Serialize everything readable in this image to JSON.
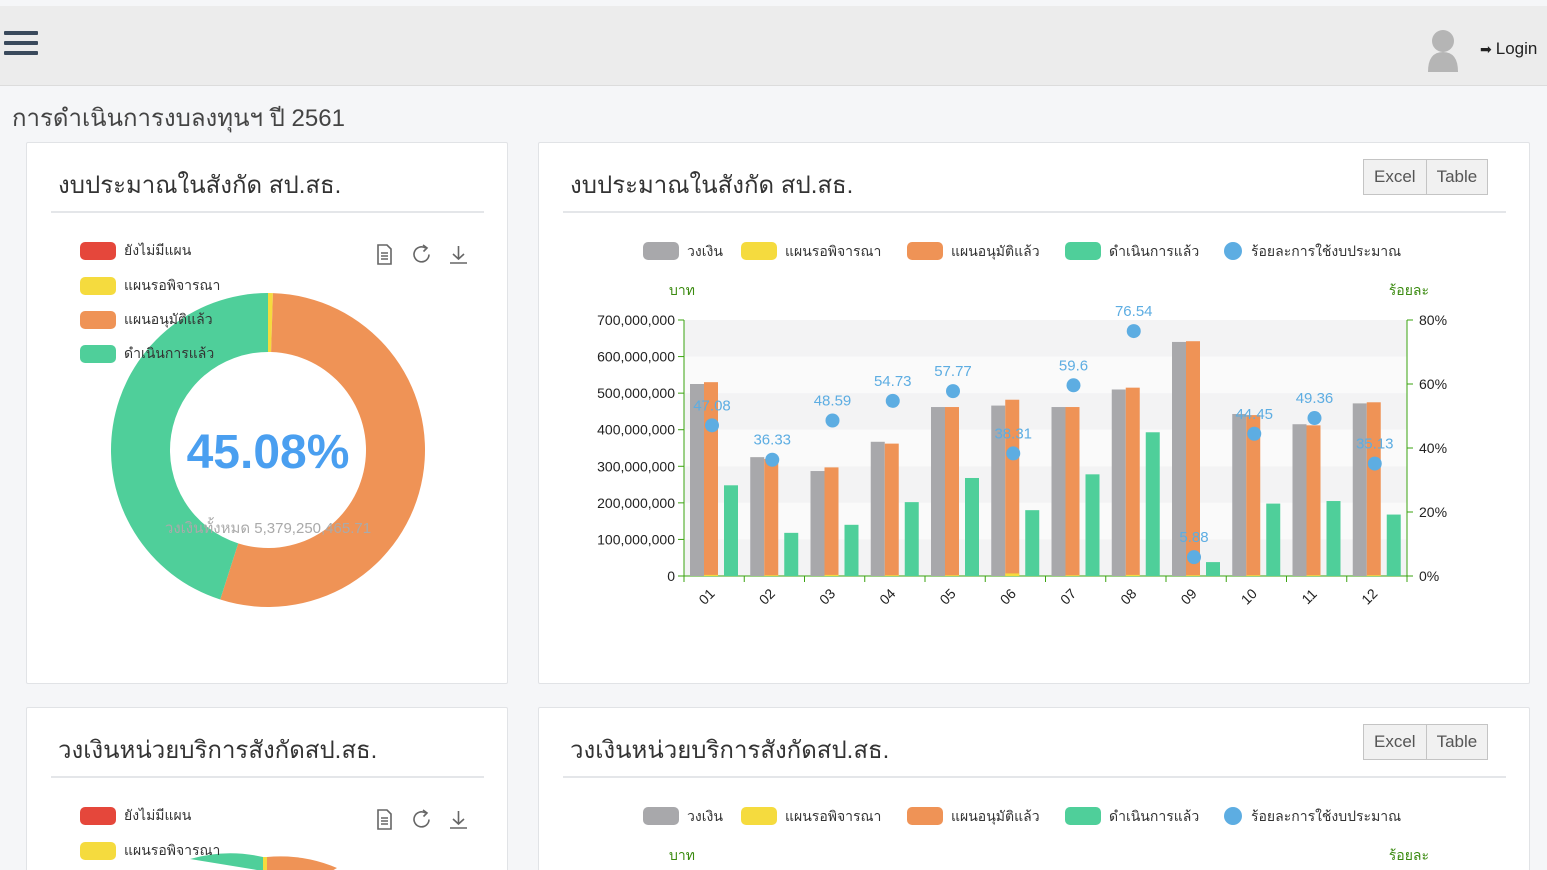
{
  "header": {
    "login_label": "Login",
    "menu_icon": "hamburger-menu-icon",
    "avatar_icon": "user-avatar-icon",
    "login_icon": "sign-in-icon"
  },
  "page": {
    "title": "การดำเนินการงบลงทุนฯ ปี 2561"
  },
  "colors": {
    "budget": "#a8a8ab",
    "pending": "#f5db3e",
    "approved": "#ef9356",
    "done": "#4fcf9a",
    "no_plan": "#e5473b",
    "percent": "#5dade2",
    "axis_green": "#3aa30f"
  },
  "panel1": {
    "title": "งบประมาณในสังกัด สป.สธ.",
    "legend": [
      "ยังไม่มีแผน",
      "แผนรอพิจารณา",
      "แผนอนุมัติแล้ว",
      "ดำเนินการแล้ว"
    ],
    "tools": [
      "document-icon",
      "refresh-icon",
      "download-icon"
    ],
    "center_value": "45.08%",
    "subtitle": "วงเงินทั้งหมด 5,379,250,465.71"
  },
  "panel2": {
    "title": "งบประมาณในสังกัด สป.สธ.",
    "excel_label": "Excel",
    "table_label": "Table",
    "legend": [
      "วงเงิน",
      "แผนรอพิจารณา",
      "แผนอนุมัติแล้ว",
      "ดำเนินการแล้ว",
      "ร้อยละการใช้งบประมาณ"
    ],
    "left_axis_name": "บาท",
    "right_axis_name": "ร้อยละ"
  },
  "panel3": {
    "title": "วงเงินหน่วยบริการสังกัดสป.สธ.",
    "legend": [
      "ยังไม่มีแผน",
      "แผนรอพิจารณา"
    ]
  },
  "panel4": {
    "title": "วงเงินหน่วยบริการสังกัดสป.สธ.",
    "excel_label": "Excel",
    "table_label": "Table",
    "legend": [
      "วงเงิน",
      "แผนรอพิจารณา",
      "แผนอนุมัติแล้ว",
      "ดำเนินการแล้ว",
      "ร้อยละการใช้งบประมาณ"
    ],
    "left_axis_name": "บาท",
    "right_axis_name": "ร้อยละ"
  },
  "chart_data": [
    {
      "type": "pie",
      "variant": "donut",
      "categories": [
        "ยังไม่มีแผน",
        "แผนรอพิจารณา",
        "แผนอนุมัติแล้ว",
        "ดำเนินการแล้ว"
      ],
      "values": [
        0.0,
        0.5,
        54.42,
        45.08
      ],
      "unit": "%"
    },
    {
      "type": "bar",
      "categories": [
        "01",
        "02",
        "03",
        "04",
        "05",
        "06",
        "07",
        "08",
        "09",
        "10",
        "11",
        "12"
      ],
      "series": [
        {
          "name": "วงเงิน",
          "values": [
            525000000,
            325000000,
            287000000,
            367000000,
            462000000,
            466000000,
            462000000,
            510000000,
            640000000,
            443000000,
            415000000,
            472000000
          ]
        },
        {
          "name": "แผนรอพิจารณา",
          "values": [
            3000000,
            2000000,
            3000000,
            2000000,
            2000000,
            7000000,
            2000000,
            3000000,
            2000000,
            2000000,
            2000000,
            2000000
          ]
        },
        {
          "name": "แผนอนุมัติแล้ว",
          "values": [
            530000000,
            320000000,
            297000000,
            362000000,
            462000000,
            482000000,
            462000000,
            515000000,
            642000000,
            440000000,
            412000000,
            475000000
          ]
        },
        {
          "name": "ดำเนินการแล้ว",
          "values": [
            248000000,
            118000000,
            140000000,
            202000000,
            268000000,
            180000000,
            278000000,
            393000000,
            38000000,
            198000000,
            205000000,
            168000000
          ]
        },
        {
          "name": "ร้อยละการใช้งบประมาณ",
          "axis": "right",
          "values": [
            47.08,
            36.33,
            48.59,
            54.73,
            57.77,
            38.31,
            59.6,
            76.54,
            5.88,
            44.45,
            49.36,
            35.13
          ]
        }
      ],
      "data_labels": [
        "47.08",
        "36.33",
        "48.59",
        "54.73",
        "57.77",
        "38.31",
        "59.6",
        "76.54",
        "5.88",
        "44.45",
        "49.36",
        "35.13"
      ],
      "ylim": [
        0,
        700000000
      ],
      "yticks": [
        "700,000,000",
        "600,000,000",
        "500,000,000",
        "400,000,000",
        "300,000,000",
        "200,000,000",
        "100,000,000",
        "0"
      ],
      "y2lim": [
        0,
        80
      ],
      "y2ticks": [
        "80%",
        "60%",
        "40%",
        "20%",
        "0%"
      ],
      "ylabel": "บาท",
      "y2label": "ร้อยละ",
      "legend_position": "top"
    },
    {
      "type": "pie",
      "variant": "donut",
      "categories": [
        "ยังไม่มีแผน",
        "แผนรอพิจารณา"
      ],
      "values": []
    }
  ]
}
